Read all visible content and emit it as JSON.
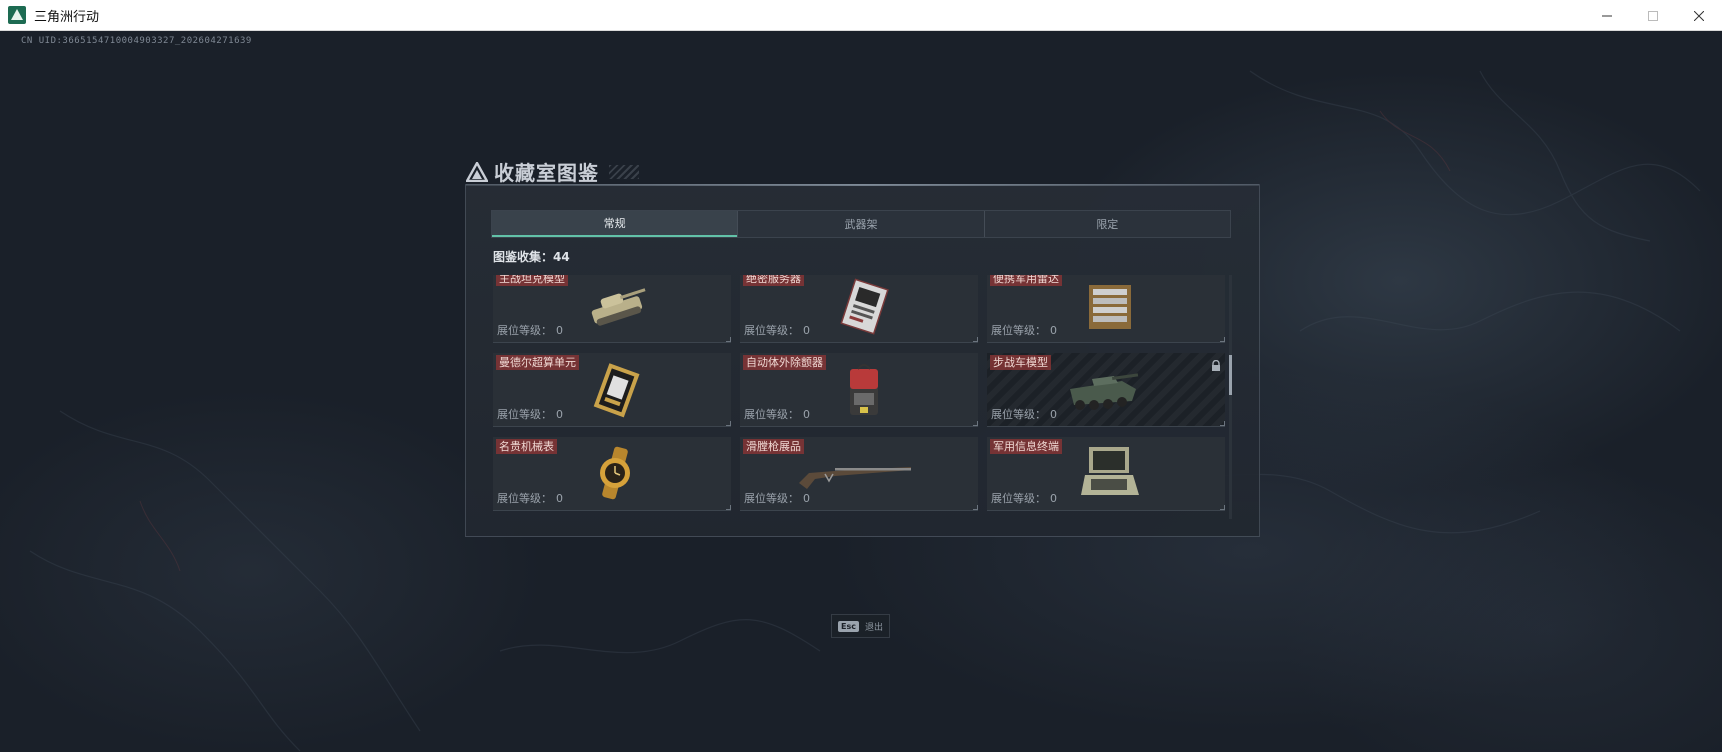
{
  "window": {
    "title": "三角洲行动",
    "controls": [
      "minimize",
      "maximize",
      "close"
    ]
  },
  "uid_text": "CN UID:3665154710004903327_202604271639",
  "panel": {
    "title": "收藏室图鉴",
    "tabs": [
      {
        "label": "常规",
        "active": true
      },
      {
        "label": "武器架",
        "active": false
      },
      {
        "label": "限定",
        "active": false
      }
    ],
    "count_label": "图鉴收集：44",
    "level_label": "展位等级：",
    "items": [
      {
        "name": "主战坦克模型",
        "level": "0",
        "icon": "tank-model-icon",
        "locked": false
      },
      {
        "name": "绝密服务器",
        "level": "0",
        "icon": "server-card-icon",
        "locked": false
      },
      {
        "name": "便携军用雷达",
        "level": "0",
        "icon": "radar-icon",
        "locked": false
      },
      {
        "name": "曼德尔超算单元",
        "level": "0",
        "icon": "supercomputer-icon",
        "locked": false
      },
      {
        "name": "自动体外除颤器",
        "level": "0",
        "icon": "defibrillator-icon",
        "locked": false
      },
      {
        "name": "步战车模型",
        "level": "0",
        "icon": "ifv-model-icon",
        "locked": true
      },
      {
        "name": "名贵机械表",
        "level": "0",
        "icon": "watch-icon",
        "locked": false
      },
      {
        "name": "滑膛枪展品",
        "level": "0",
        "icon": "musket-icon",
        "locked": false
      },
      {
        "name": "军用信息终端",
        "level": "0",
        "icon": "terminal-icon",
        "locked": false
      }
    ]
  },
  "esc_hint": {
    "key": "Esc",
    "label": "退出"
  },
  "colors": {
    "accent": "#62c2a8",
    "name_tag": "#8c3434",
    "background": "#1a2029"
  }
}
